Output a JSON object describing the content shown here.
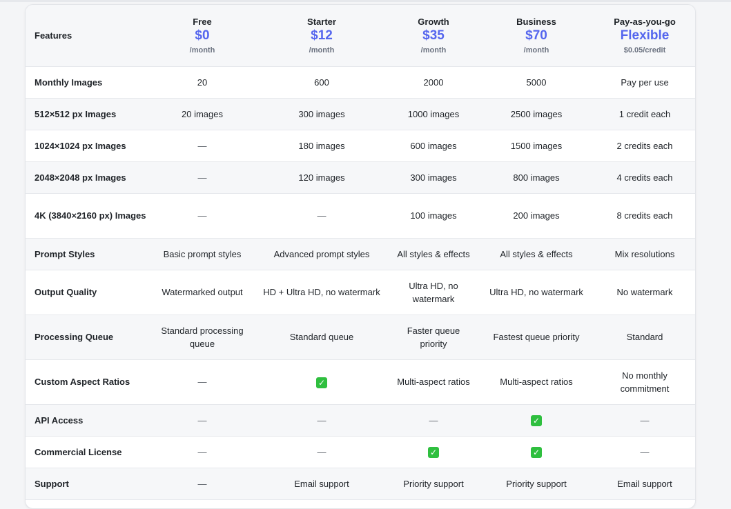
{
  "header": {
    "features_label": "Features",
    "plans": [
      {
        "name": "Free",
        "price": "$0",
        "unit": "/month"
      },
      {
        "name": "Starter",
        "price": "$12",
        "unit": "/month"
      },
      {
        "name": "Growth",
        "price": "$35",
        "unit": "/month"
      },
      {
        "name": "Business",
        "price": "$70",
        "unit": "/month"
      },
      {
        "name": "Pay-as-you-go",
        "price": "Flexible",
        "unit": "$0.05/credit"
      }
    ]
  },
  "symbols": {
    "dash": "—",
    "check": "✓"
  },
  "rows": [
    {
      "feature": "Monthly Images",
      "cells": [
        "20",
        "600",
        "2000",
        "5000",
        "Pay per use"
      ]
    },
    {
      "feature": "512×512 px Images",
      "cells": [
        "20 images",
        "300 images",
        "1000 images",
        "2500 images",
        "1 credit each"
      ]
    },
    {
      "feature": "1024×1024 px Images",
      "cells": [
        "—",
        "180 images",
        "600 images",
        "1500 images",
        "2 credits each"
      ]
    },
    {
      "feature": "2048×2048 px Images",
      "cells": [
        "—",
        "120 images",
        "300 images",
        "800 images",
        "4 credits each"
      ]
    },
    {
      "feature": "4K (3840×2160 px) Images",
      "cells": [
        "—",
        "—",
        "100 images",
        "200 images",
        "8 credits each"
      ]
    },
    {
      "feature": "Prompt Styles",
      "cells": [
        "Basic prompt styles",
        "Advanced prompt styles",
        "All styles & effects",
        "All styles & effects",
        "Mix resolutions"
      ]
    },
    {
      "feature": "Output Quality",
      "cells": [
        "Watermarked output",
        "HD + Ultra HD, no watermark",
        "Ultra HD, no watermark",
        "Ultra HD, no watermark",
        "No watermark"
      ]
    },
    {
      "feature": "Processing Queue",
      "cells": [
        "Standard processing queue",
        "Standard queue",
        "Faster queue priority",
        "Fastest queue priority",
        "Standard"
      ]
    },
    {
      "feature": "Custom Aspect Ratios",
      "cells": [
        "—",
        "✓",
        "Multi-aspect ratios",
        "Multi-aspect ratios",
        "No monthly commitment"
      ]
    },
    {
      "feature": "API Access",
      "cells": [
        "—",
        "—",
        "—",
        "✓",
        "—"
      ]
    },
    {
      "feature": "Commercial License",
      "cells": [
        "—",
        "—",
        "✓",
        "✓",
        "—"
      ]
    },
    {
      "feature": "Support",
      "cells": [
        "—",
        "Email support",
        "Priority support",
        "Priority support",
        "Email support"
      ]
    }
  ],
  "colors": {
    "accent": "#5566ee",
    "check": "#2fbf3f",
    "header_bg": "#f6f7f9"
  }
}
